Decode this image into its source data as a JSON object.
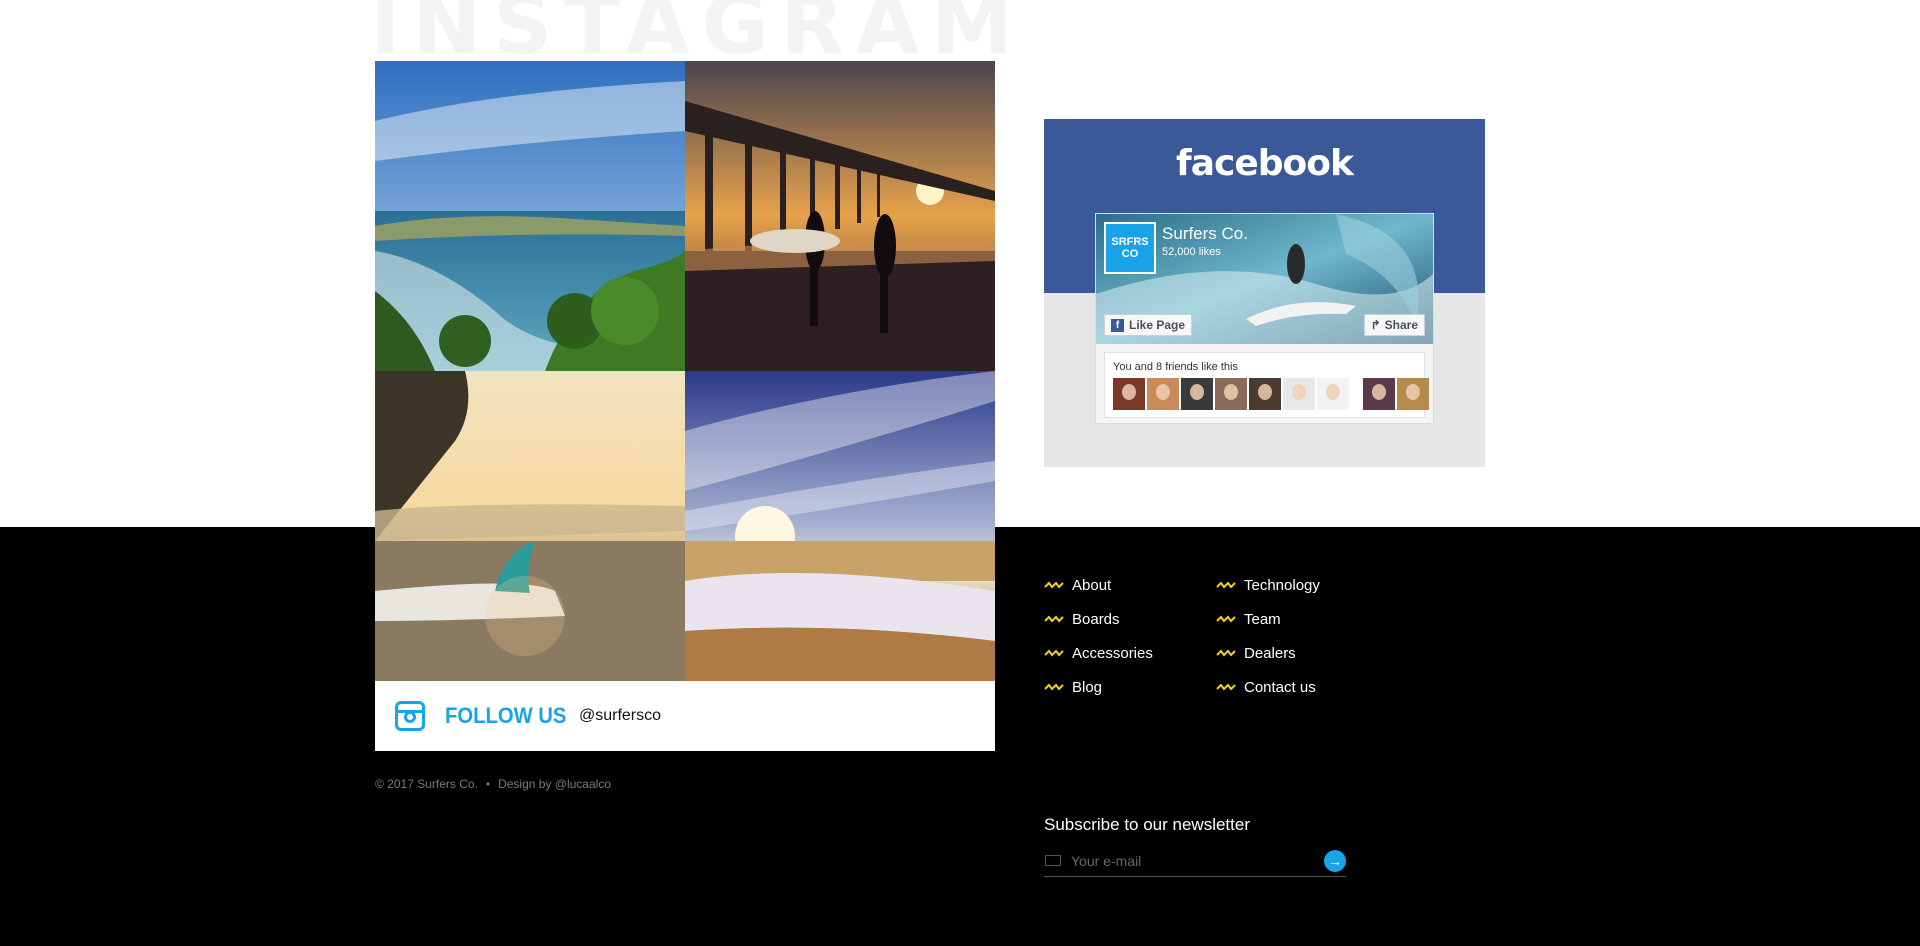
{
  "instagram": {
    "heading": "INSTAGRAM",
    "photos": [
      "beach-cove",
      "pier-surfers",
      "surfboard-fin",
      "sunset-waves"
    ],
    "follow_label": "FOLLOW US",
    "handle": "@surfersco",
    "accent": "#1aa3e6"
  },
  "facebook": {
    "logo": "facebook",
    "page_name": "Surfers Co.",
    "likes": "52,000 likes",
    "avatar_text": "SRFRS CO",
    "like_button": "Like Page",
    "share_button": "Share",
    "friends_text": "You and 8 friends like this",
    "brand_color": "#3b5998"
  },
  "footer": {
    "copyright": "© 2017 Surfers Co.",
    "design_credit": "Design by @lucaalco",
    "nav_col1": [
      "About",
      "Boards",
      "Accessories",
      "Blog"
    ],
    "nav_col2": [
      "Technology",
      "Team",
      "Dealers",
      "Contact us"
    ],
    "wave_color": "#f2d21a"
  },
  "newsletter": {
    "title": "Subscribe to our newsletter",
    "placeholder": "Your e-mail"
  }
}
